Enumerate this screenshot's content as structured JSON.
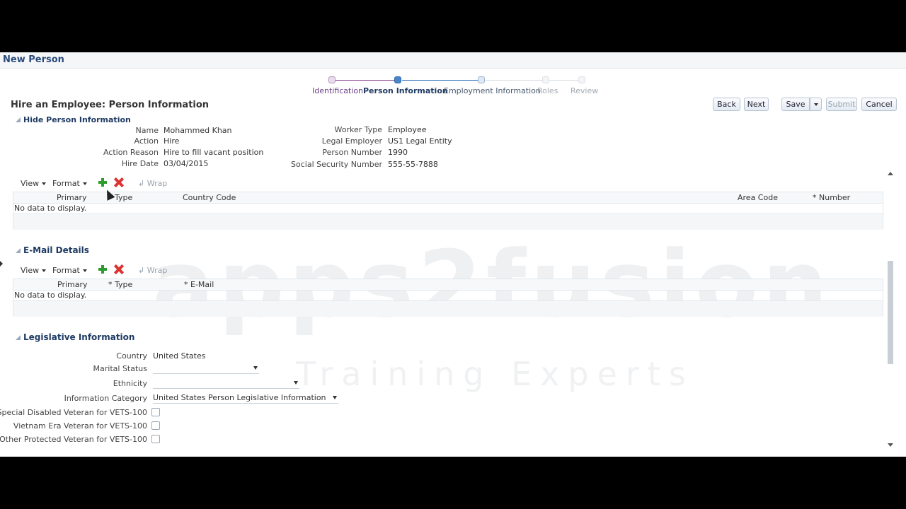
{
  "window": {
    "title": "New Person"
  },
  "train": {
    "steps": [
      {
        "label": "Identification",
        "state": "done"
      },
      {
        "label": "Person Information",
        "state": "current"
      },
      {
        "label": "Employment Information",
        "state": "next"
      },
      {
        "label": "Roles",
        "state": "disabled"
      },
      {
        "label": "Review",
        "state": "disabled"
      }
    ]
  },
  "page": {
    "title": "Hire an Employee: Person Information"
  },
  "buttons": {
    "back": "Back",
    "next": "Next",
    "save": "Save",
    "submit": "Submit",
    "cancel": "Cancel"
  },
  "person_info": {
    "toggle_label": "Hide Person Information",
    "left": [
      {
        "label": "Name",
        "value": "Mohammed Khan"
      },
      {
        "label": "Action",
        "value": "Hire"
      },
      {
        "label": "Action Reason",
        "value": "Hire to fill vacant position"
      },
      {
        "label": "Hire Date",
        "value": "03/04/2015"
      }
    ],
    "right": [
      {
        "label": "Worker Type",
        "value": "Employee"
      },
      {
        "label": "Legal Employer",
        "value": "US1 Legal Entity"
      },
      {
        "label": "Person Number",
        "value": "1990"
      },
      {
        "label": "Social Security Number",
        "value": "555-55-7888"
      }
    ]
  },
  "phone_table": {
    "toolbar": {
      "view": "View",
      "format": "Format",
      "wrap": "Wrap"
    },
    "columns": [
      "Primary",
      "Type",
      "Country Code",
      "Area Code",
      "* Number"
    ],
    "empty": "No data to display."
  },
  "email": {
    "title": "E-Mail Details",
    "toolbar": {
      "view": "View",
      "format": "Format",
      "wrap": "Wrap"
    },
    "columns": [
      "Primary",
      "* Type",
      "* E-Mail"
    ],
    "empty": "No data to display."
  },
  "legislative": {
    "title": "Legislative Information",
    "country_label": "Country",
    "country_value": "United States",
    "marital_label": "Marital Status",
    "marital_value": "",
    "ethnicity_label": "Ethnicity",
    "ethnicity_value": "",
    "info_cat_label": "Information Category",
    "info_cat_value": "United States Person Legislative Information",
    "checkboxes": [
      {
        "label": "Special Disabled Veteran for VETS-100",
        "checked": false
      },
      {
        "label": "Vietnam Era Veteran for VETS-100",
        "checked": false
      },
      {
        "label": "Other Protected Veteran for VETS-100",
        "checked": false
      }
    ]
  },
  "watermark": {
    "main": "apps2fusion",
    "sub": "Training Experts"
  }
}
